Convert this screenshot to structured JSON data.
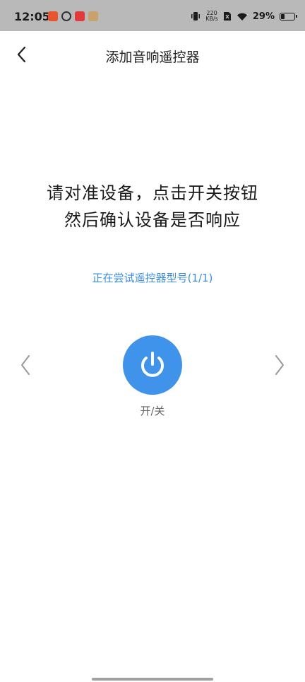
{
  "status_bar": {
    "time": "12:05",
    "net_speed_value": "220",
    "net_speed_unit": "KB/s",
    "battery_pct": "29%",
    "battery_level": 0.29,
    "notif_icons": [
      "app-notification-icon-1",
      "app-notification-icon-2",
      "app-notification-icon-3",
      "app-notification-icon-4"
    ],
    "icons": [
      "vibrate-icon",
      "sim-off-icon",
      "wifi-icon",
      "battery-icon"
    ]
  },
  "header": {
    "title": "添加音响遥控器",
    "back_icon": "chevron-left-icon"
  },
  "instruction": {
    "line1": "请对准设备，点击开关按钮",
    "line2": "然后确认设备是否响应"
  },
  "trying_text": "正在尝试遥控器型号(1/1)",
  "power": {
    "label": "开/关",
    "icon": "power-icon"
  },
  "colors": {
    "accent": "#3f93ea",
    "trying_text": "#3a8ee6",
    "status_bar_bg": "#b9b9b9"
  }
}
